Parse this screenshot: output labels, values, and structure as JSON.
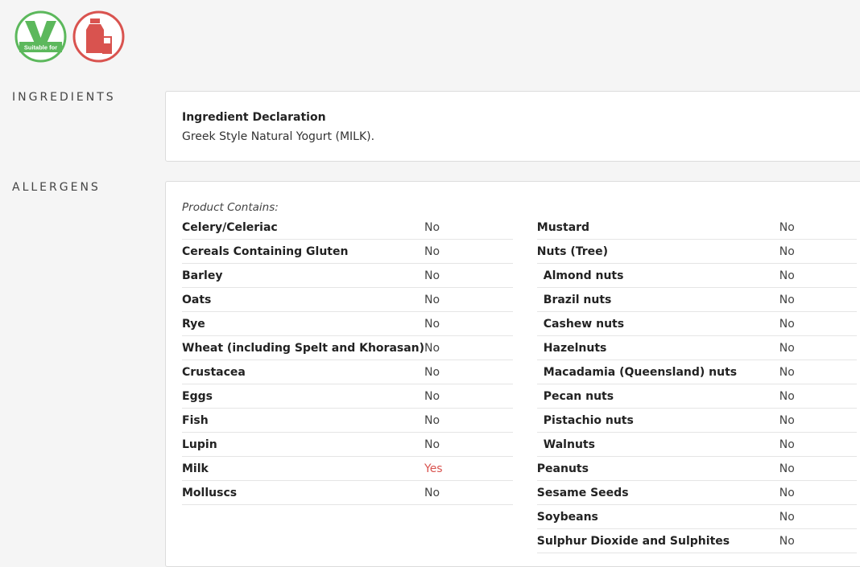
{
  "badges": {
    "vegetarian_text": "Suitable for",
    "vegetarian_color": "#5cb85c",
    "milk_color": "#d9534f"
  },
  "sections": {
    "ingredients_label": "INGREDIENTS",
    "allergens_label": "ALLERGENS"
  },
  "ingredients": {
    "title": "Ingredient Declaration",
    "text": "Greek Style Natural Yogurt (MILK)."
  },
  "allergens": {
    "contains_label": "Product Contains:",
    "left": [
      {
        "name": "Celery/Celeriac",
        "value": "No"
      },
      {
        "name": "Cereals Containing Gluten",
        "value": "No"
      },
      {
        "name": "Barley",
        "value": "No"
      },
      {
        "name": "Oats",
        "value": "No"
      },
      {
        "name": "Rye",
        "value": "No"
      },
      {
        "name": "Wheat (including Spelt and Khorasan)",
        "value": "No"
      },
      {
        "name": "Crustacea",
        "value": "No"
      },
      {
        "name": "Eggs",
        "value": "No"
      },
      {
        "name": "Fish",
        "value": "No"
      },
      {
        "name": "Lupin",
        "value": "No"
      },
      {
        "name": "Milk",
        "value": "Yes"
      },
      {
        "name": "Molluscs",
        "value": "No"
      }
    ],
    "right": [
      {
        "name": "Mustard",
        "value": "No"
      },
      {
        "name": "Nuts (Tree)",
        "value": "No"
      },
      {
        "name": "Almond nuts",
        "value": "No"
      },
      {
        "name": "Brazil nuts",
        "value": "No"
      },
      {
        "name": "Cashew nuts",
        "value": "No"
      },
      {
        "name": "Hazelnuts",
        "value": "No"
      },
      {
        "name": "Macadamia (Queensland) nuts",
        "value": "No"
      },
      {
        "name": "Pecan nuts",
        "value": "No"
      },
      {
        "name": "Pistachio nuts",
        "value": "No"
      },
      {
        "name": "Walnuts",
        "value": "No"
      },
      {
        "name": "Peanuts",
        "value": "No"
      },
      {
        "name": "Sesame Seeds",
        "value": "No"
      },
      {
        "name": "Soybeans",
        "value": "No"
      },
      {
        "name": "Sulphur Dioxide and Sulphites",
        "value": "No"
      }
    ]
  }
}
